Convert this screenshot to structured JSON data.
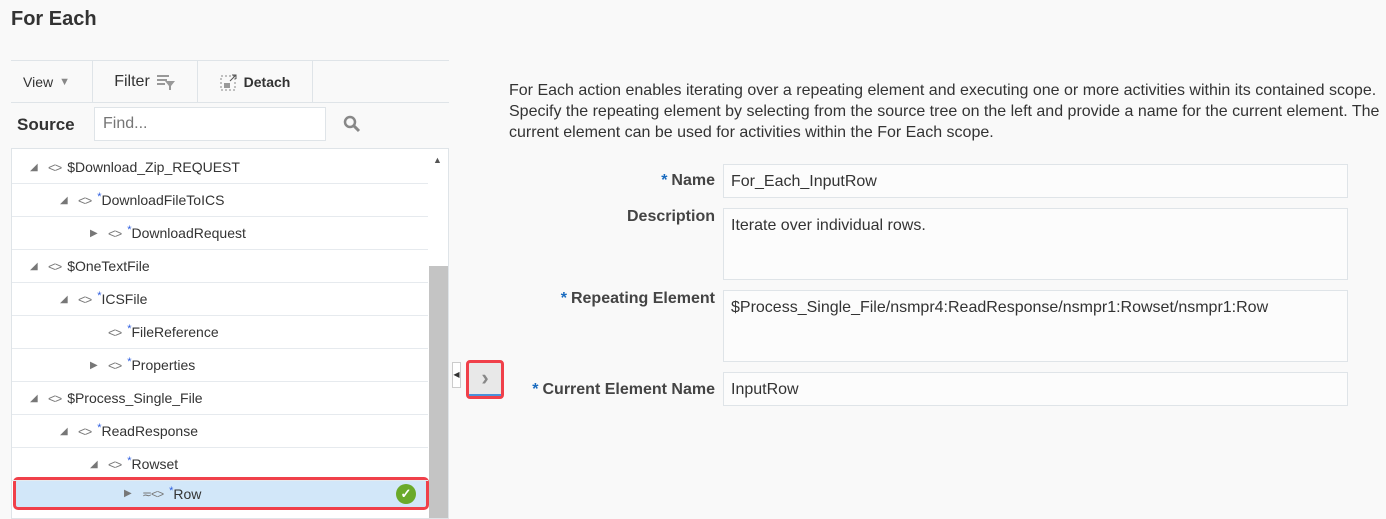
{
  "title": "For Each",
  "toolbar": {
    "view": "View",
    "filter": "Filter",
    "detach": "Detach"
  },
  "source": {
    "label": "Source",
    "placeholder": "Find..."
  },
  "tree": [
    {
      "label": "$Download_Zip_REQUEST",
      "level": 0,
      "toggle": "expanded",
      "required": false
    },
    {
      "label": "DownloadFileToICS",
      "level": 1,
      "toggle": "expanded",
      "required": true
    },
    {
      "label": "DownloadRequest",
      "level": 2,
      "toggle": "collapsed",
      "required": true
    },
    {
      "label": "$OneTextFile",
      "level": 0,
      "toggle": "expanded",
      "required": false
    },
    {
      "label": "ICSFile",
      "level": 1,
      "toggle": "expanded",
      "required": true
    },
    {
      "label": "FileReference",
      "level": 2,
      "toggle": "none",
      "required": true
    },
    {
      "label": "Properties",
      "level": 2,
      "toggle": "collapsed",
      "required": true
    },
    {
      "label": "$Process_Single_File",
      "level": 0,
      "toggle": "expanded",
      "required": false
    },
    {
      "label": "ReadResponse",
      "level": 1,
      "toggle": "expanded",
      "required": true
    },
    {
      "label": "Rowset",
      "level": 2,
      "toggle": "expanded",
      "required": true
    },
    {
      "label": "Row",
      "level": 3,
      "toggle": "collapsed",
      "required": true,
      "selected": true,
      "repeating": true
    }
  ],
  "description": "For Each action enables iterating over a repeating element and executing one or more activities within its contained scope. Specify the repeating element by selecting from the source tree on the left and provide a name for the current element. The current element can be used for activities within the For Each scope.",
  "form": {
    "required_mark": "*",
    "name_label": "Name",
    "name_value": "For_Each_InputRow",
    "description_label": "Description",
    "description_value": "Iterate over individual rows.",
    "repeating_label": "Repeating Element",
    "repeating_value": "$Process_Single_File/nsmpr4:ReadResponse/nsmpr1:Rowset/nsmpr1:Row",
    "current_label": "Current Element Name",
    "current_value": "InputRow"
  }
}
